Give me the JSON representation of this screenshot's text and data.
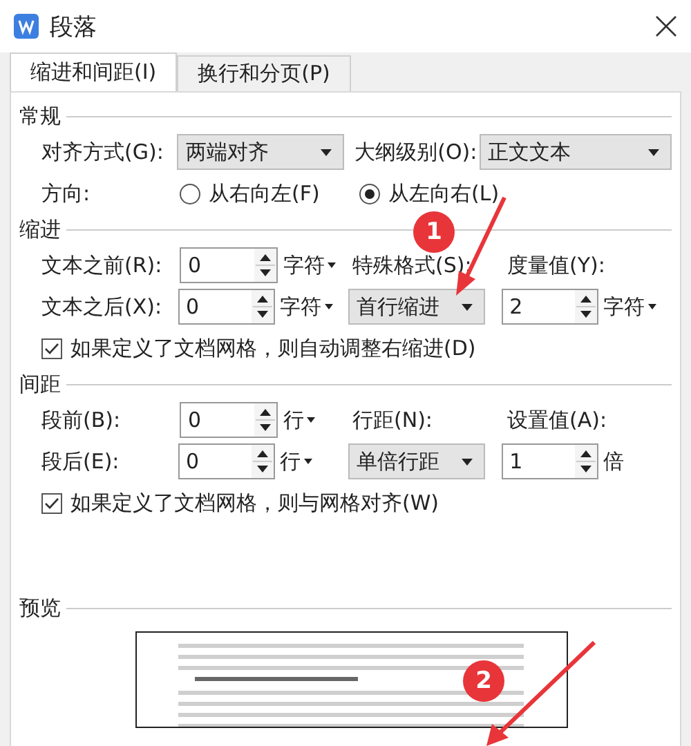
{
  "window": {
    "title": "段落"
  },
  "tabs": [
    {
      "label": "缩进和间距(I)",
      "selected": true
    },
    {
      "label": "换行和分页(P)",
      "selected": false
    }
  ],
  "general": {
    "title": "常规",
    "alignment": {
      "label": "对齐方式(G):",
      "value": "两端对齐"
    },
    "outline_level": {
      "label": "大纲级别(O):",
      "value": "正文文本"
    },
    "direction": {
      "label": "方向:",
      "options": [
        {
          "label": "从右向左(F)",
          "selected": false
        },
        {
          "label": "从左向右(L)",
          "selected": true
        }
      ]
    }
  },
  "indent": {
    "title": "缩进",
    "before": {
      "label": "文本之前(R):",
      "value": "0",
      "unit": "字符",
      "unit_dropdown": true
    },
    "after": {
      "label": "文本之后(X):",
      "value": "0",
      "unit": "字符",
      "unit_dropdown": true
    },
    "special": {
      "label": "特殊格式(S):",
      "value": "首行缩进"
    },
    "by": {
      "label": "度量值(Y):",
      "value": "2",
      "unit": "字符",
      "unit_dropdown": true
    },
    "auto_adjust": {
      "label": "如果定义了文档网格，则自动调整右缩进(D)",
      "checked": true
    }
  },
  "spacing": {
    "title": "间距",
    "before": {
      "label": "段前(B):",
      "value": "0",
      "unit": "行",
      "unit_dropdown": true
    },
    "after": {
      "label": "段后(E):",
      "value": "0",
      "unit": "行",
      "unit_dropdown": true
    },
    "line_spacing": {
      "label": "行距(N):",
      "value": "单倍行距"
    },
    "at": {
      "label": "设置值(A):",
      "value": "1",
      "unit": "倍",
      "unit_dropdown": false
    },
    "snap_to_grid": {
      "label": "如果定义了文档网格，则与网格对齐(W)",
      "checked": true
    }
  },
  "preview": {
    "title": "预览"
  },
  "annotations": [
    {
      "label": "1"
    },
    {
      "label": "2"
    }
  ]
}
